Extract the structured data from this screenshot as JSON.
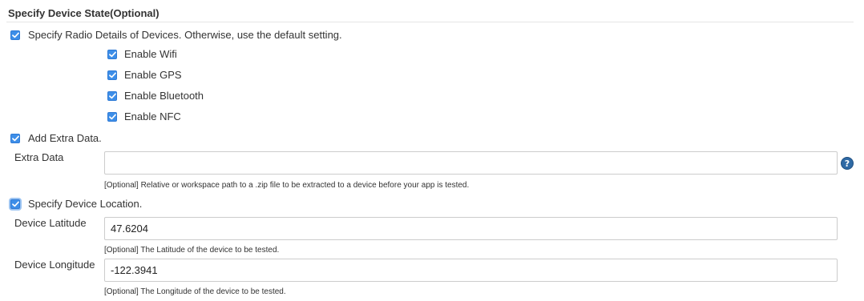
{
  "section": {
    "title": "Specify Device State(Optional)"
  },
  "radio": {
    "label": "Specify Radio Details of Devices. Otherwise, use the default setting.",
    "checked": true,
    "options": [
      {
        "label": "Enable Wifi",
        "checked": true
      },
      {
        "label": "Enable GPS",
        "checked": true
      },
      {
        "label": "Enable Bluetooth",
        "checked": true
      },
      {
        "label": "Enable NFC",
        "checked": true
      }
    ]
  },
  "extra_data": {
    "checkbox_label": "Add Extra Data.",
    "checked": true,
    "field_label": "Extra Data",
    "value": "",
    "help": "[Optional] Relative or workspace path to a .zip file to be extracted to a device before your app is tested.",
    "help_icon": "question-mark-icon",
    "help_icon_glyph": "?"
  },
  "location": {
    "checkbox_label": "Specify Device Location.",
    "checked": true,
    "latitude": {
      "label": "Device Latitude",
      "value": "47.6204",
      "help": "[Optional] The Latitude of the device to be tested."
    },
    "longitude": {
      "label": "Device Longitude",
      "value": "-122.3941",
      "help": "[Optional] The Longitude of the device to be tested."
    }
  },
  "colors": {
    "checkbox": "#3d8ee8",
    "help_icon": "#2f6aa5",
    "border": "#cccccc"
  }
}
